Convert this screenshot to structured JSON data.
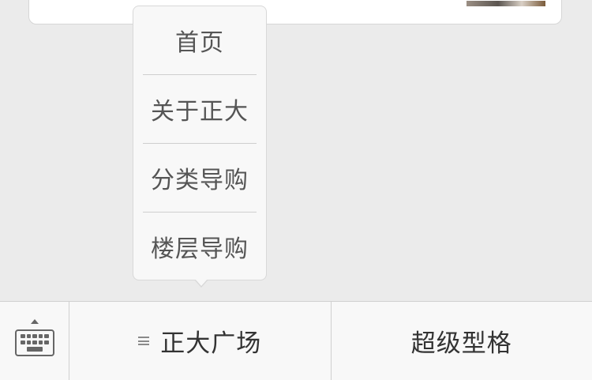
{
  "popup": {
    "items": [
      {
        "label": "首页"
      },
      {
        "label": "关于正大"
      },
      {
        "label": "分类导购"
      },
      {
        "label": "楼层导购"
      }
    ]
  },
  "bottom_bar": {
    "keyboard_icon": "keyboard-icon",
    "tabs": [
      {
        "label": "正大广场",
        "icon": "menu-icon"
      },
      {
        "label": "超级型格"
      }
    ]
  }
}
